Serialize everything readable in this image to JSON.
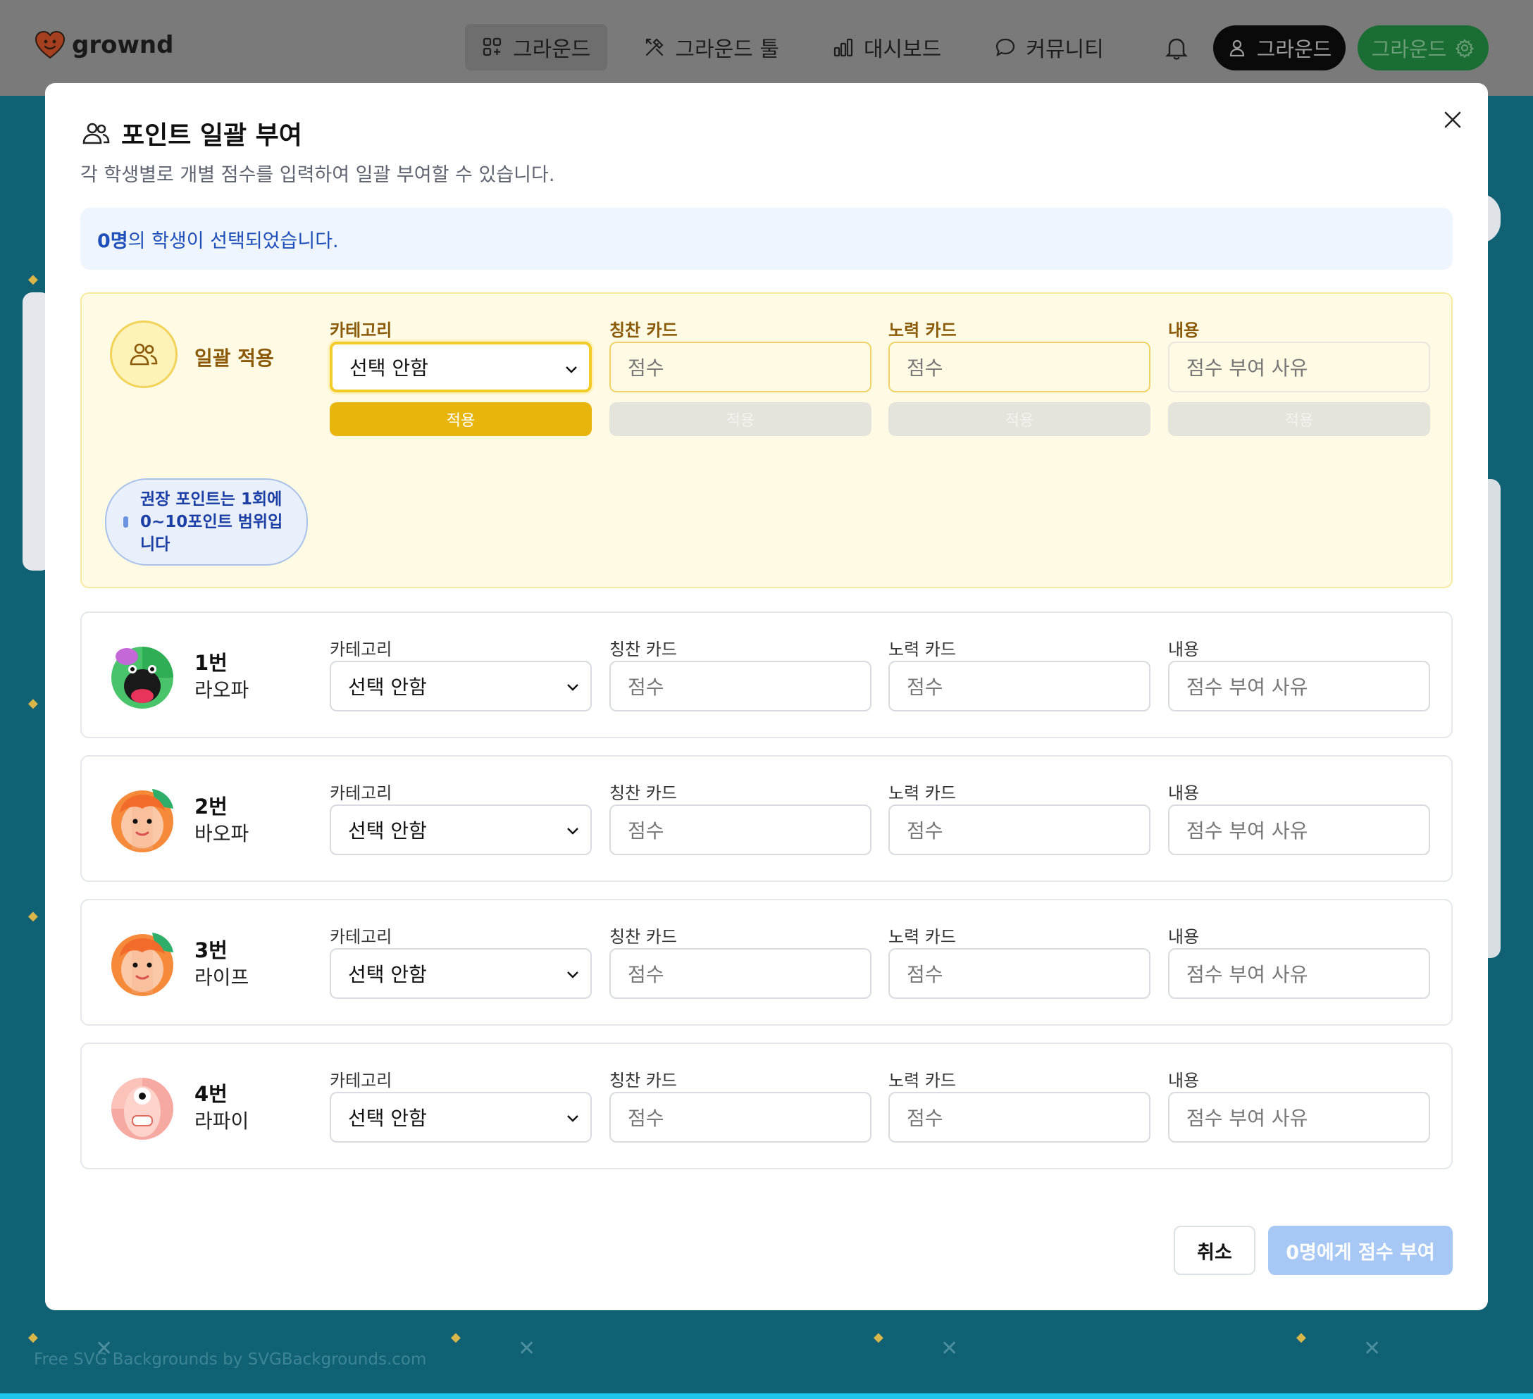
{
  "nav": {
    "logo_text": "grownd",
    "items": [
      {
        "label": "그라운드",
        "icon": "grid-plus-icon",
        "active": true
      },
      {
        "label": "그라운드 툴",
        "icon": "tools-icon",
        "active": false
      },
      {
        "label": "대시보드",
        "icon": "bar-chart-icon",
        "active": false
      },
      {
        "label": "커뮤니티",
        "icon": "chat-bubble-icon",
        "active": false
      }
    ],
    "account_label": "그라운드",
    "ground_label": "그라운드"
  },
  "background": {
    "watermark": "Free SVG Backgrounds by SVGBackgrounds.com"
  },
  "modal": {
    "title": "포인트 일괄 부여",
    "description": "각 학생별로 개별 점수를 입력하여 일괄 부여할 수 있습니다.",
    "selection": {
      "count": "0명",
      "suffix": "의 학생이 선택되었습니다."
    },
    "bulk": {
      "name": "일괄 적용",
      "tip": "권장 포인트는 1회에 0~10포인트 범위입니다",
      "fields": {
        "category": {
          "label": "카테고리",
          "value": "선택 안함",
          "apply": "적용"
        },
        "praise": {
          "label": "칭찬 카드",
          "placeholder": "점수",
          "apply": "적용"
        },
        "effort": {
          "label": "노력 카드",
          "placeholder": "점수",
          "apply": "적용"
        },
        "content": {
          "label": "내용",
          "placeholder": "점수 부여 사유",
          "apply": "적용"
        }
      }
    },
    "labels": {
      "category": "카테고리",
      "praise": "칭찬 카드",
      "effort": "노력 카드",
      "content": "내용",
      "category_value": "선택 안함",
      "score_placeholder": "점수",
      "reason_placeholder": "점수 부여 사유"
    },
    "students": [
      {
        "number": "1번",
        "name": "라오파"
      },
      {
        "number": "2번",
        "name": "바오파"
      },
      {
        "number": "3번",
        "name": "라이프"
      },
      {
        "number": "4번",
        "name": "라파이"
      }
    ],
    "cancel_label": "취소",
    "submit_label": "0명에게 점수 부여"
  },
  "colors": {
    "accent_yellow": "#e8b50c",
    "accent_blue": "#1f4fb8",
    "submit_disabled": "#a7c8f5"
  }
}
